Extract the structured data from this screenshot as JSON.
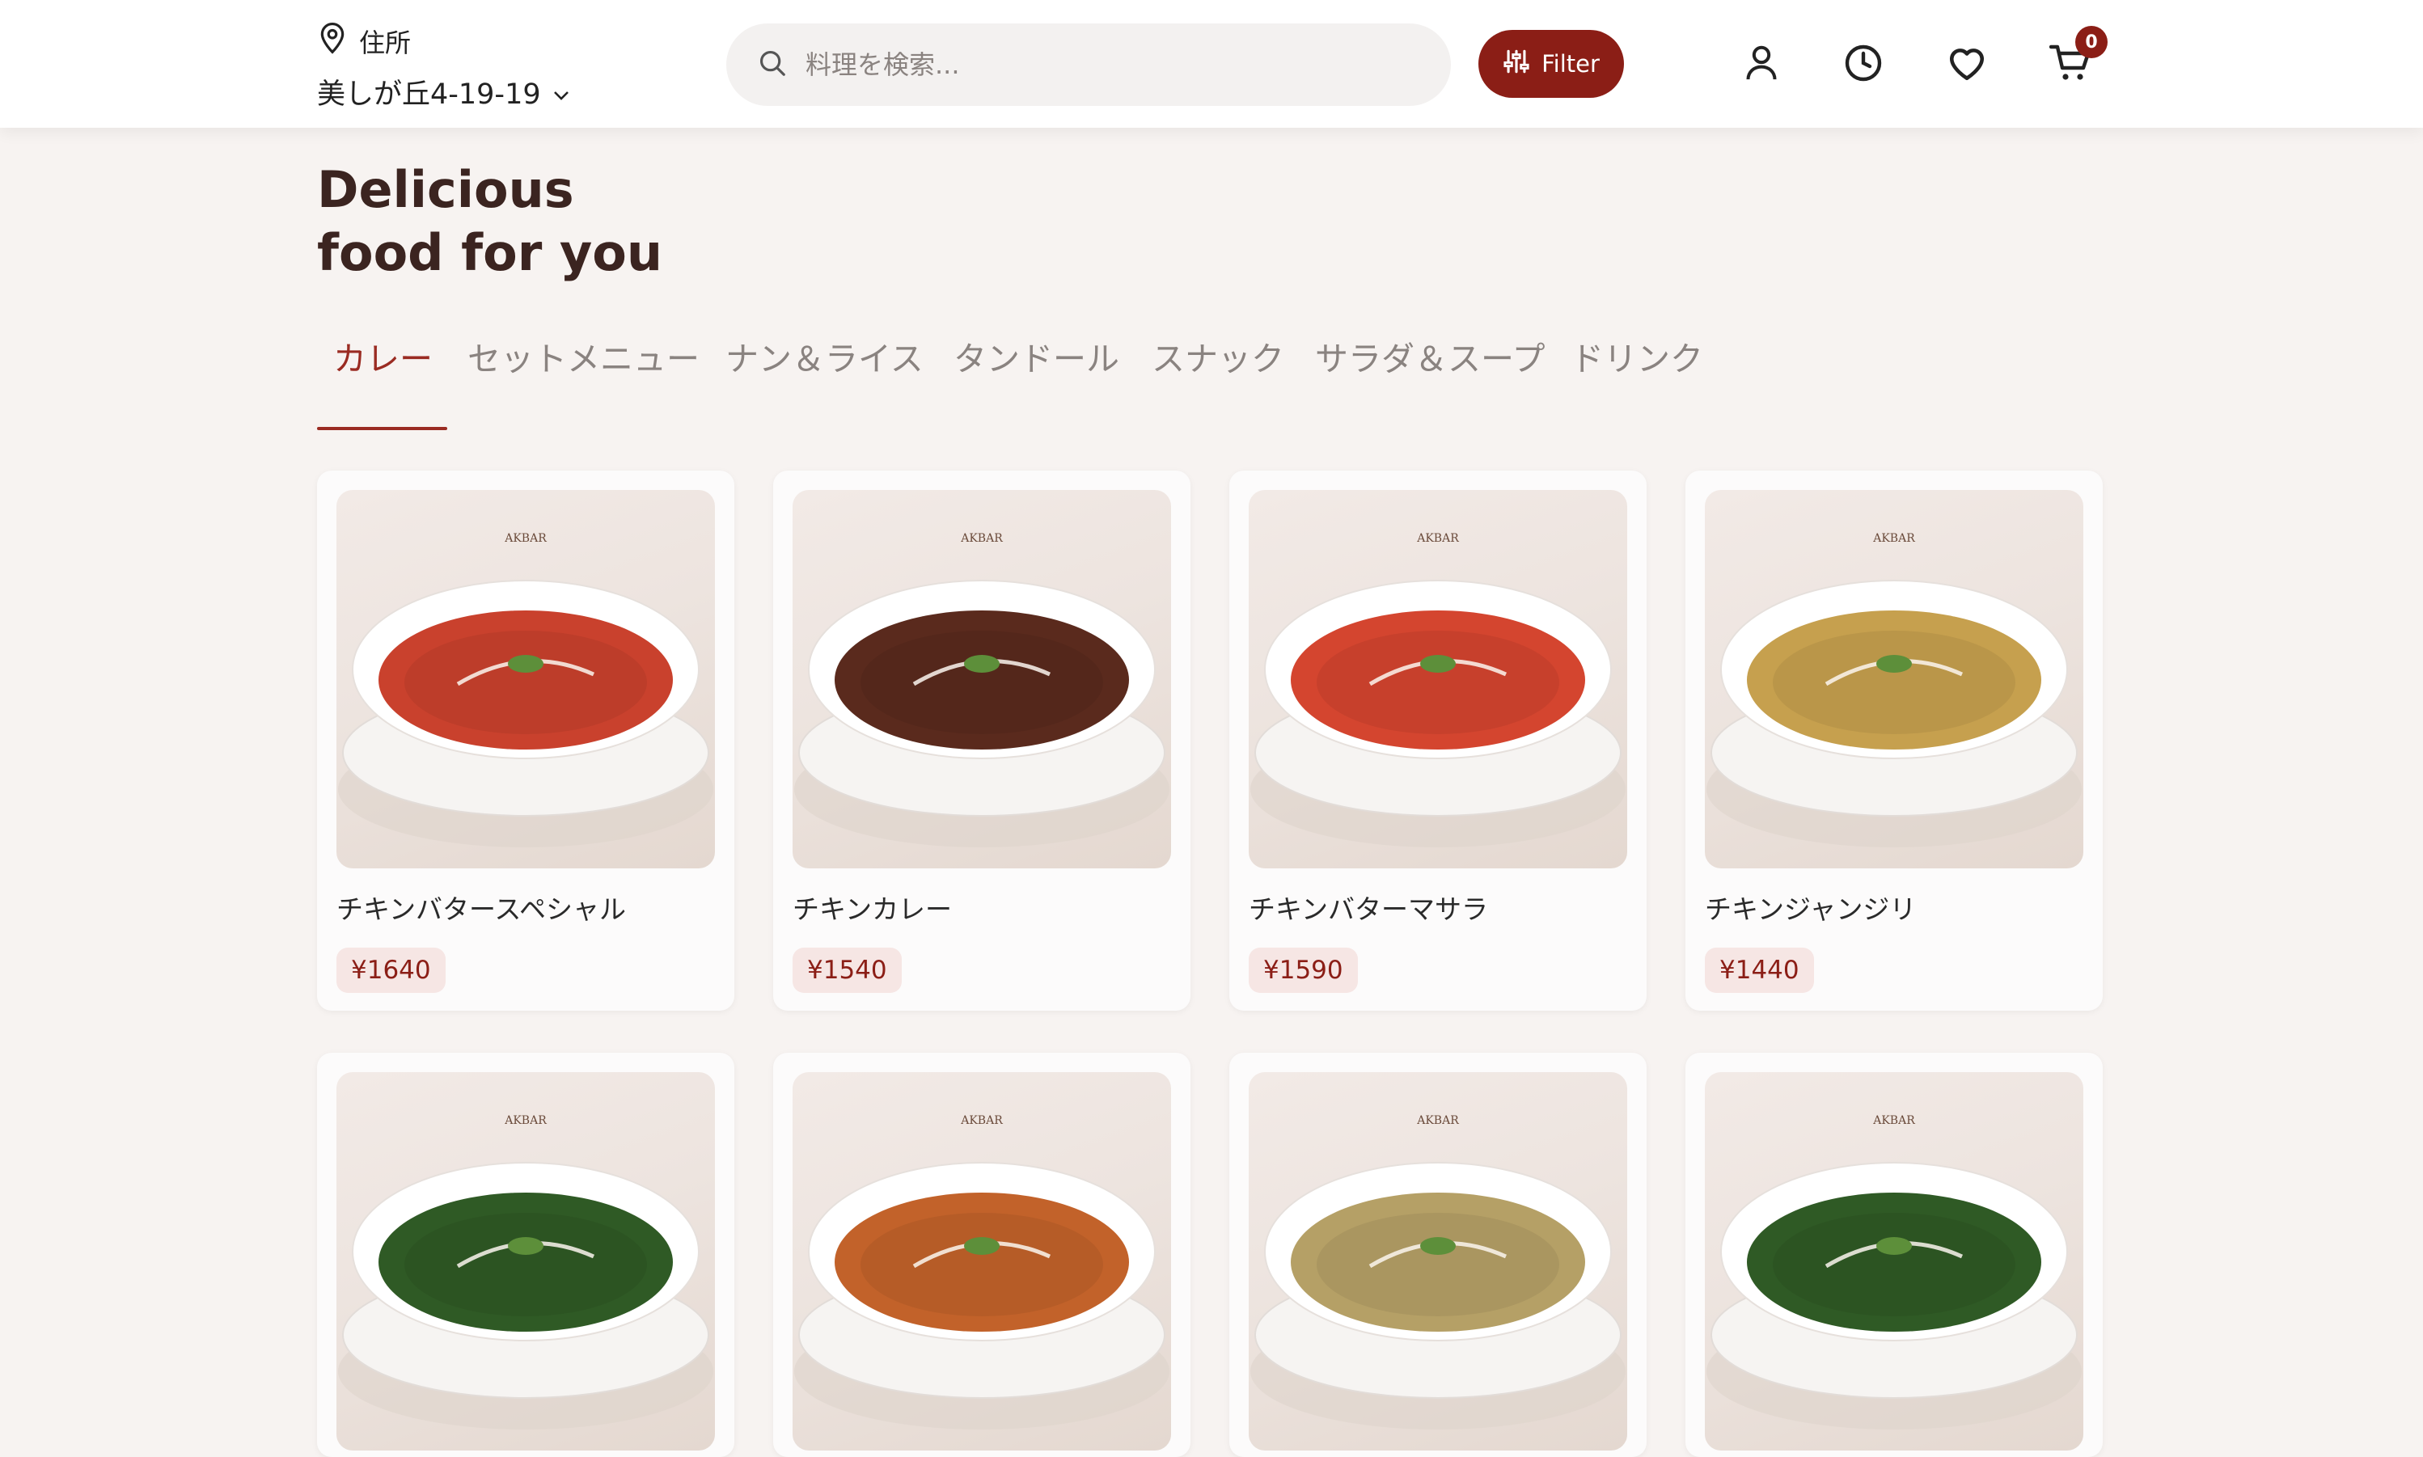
{
  "header": {
    "address_label": "住所",
    "address_value": "美しが丘4-19-19",
    "search_placeholder": "料理を検索...",
    "filter_label": "Filter",
    "cart_count": "0"
  },
  "hero": {
    "line1": "Delicious",
    "line2": "food for you"
  },
  "tabs": [
    "カレー",
    "セットメニュー",
    "ナン＆ライス",
    "タンドール",
    "スナック",
    "サラダ＆スープ",
    "ドリンク"
  ],
  "products": [
    {
      "name": "チキンバタースペシャル",
      "price": "¥1640",
      "curry_color": "#c9412d"
    },
    {
      "name": "チキンカレー",
      "price": "¥1540",
      "curry_color": "#5a2a1d"
    },
    {
      "name": "チキンバターマサラ",
      "price": "¥1590",
      "curry_color": "#d4452f"
    },
    {
      "name": "チキンジャンジリ",
      "price": "¥1440",
      "curry_color": "#c6a04e"
    },
    {
      "name": "",
      "price": "",
      "curry_color": "#2f5a25"
    },
    {
      "name": "",
      "price": "",
      "curry_color": "#c2622a"
    },
    {
      "name": "",
      "price": "",
      "curry_color": "#b5a066"
    },
    {
      "name": "",
      "price": "",
      "curry_color": "#2f5a25"
    }
  ],
  "photo_brand": "AKBAR",
  "colors": {
    "accent": "#8b1e16",
    "background": "#f7f3f1"
  },
  "icons": [
    "location-pin-icon",
    "chevron-down-icon",
    "search-icon",
    "filter-sliders-icon",
    "user-icon",
    "clock-icon",
    "heart-icon",
    "cart-icon"
  ]
}
